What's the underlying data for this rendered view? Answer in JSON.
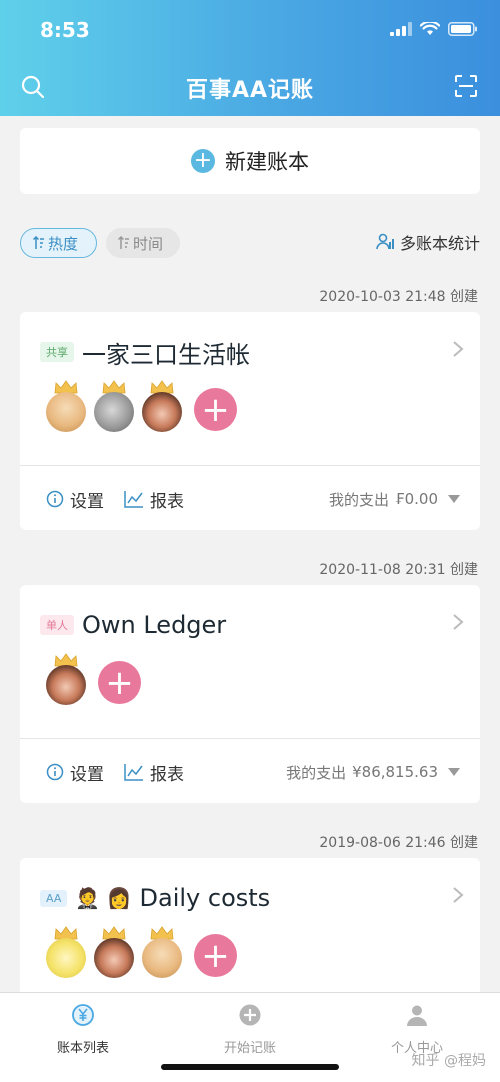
{
  "status_bar": {
    "time": "8:53"
  },
  "nav": {
    "title": "百事AA记账"
  },
  "new_book": {
    "label": "新建账本"
  },
  "sort": {
    "hot_label": "热度",
    "time_label": "时间",
    "multi_stats_label": "多账本统计"
  },
  "ledgers": [
    {
      "created": "2020-10-03 21:48 创建",
      "tag": "共享",
      "title": "一家三口生活帐",
      "settings_label": "设置",
      "report_label": "报表",
      "expense_label": "我的支出",
      "expense_value": "₣0.00"
    },
    {
      "created": "2020-11-08 20:31 创建",
      "tag": "单人",
      "title": "Own Ledger",
      "settings_label": "设置",
      "report_label": "报表",
      "expense_label": "我的支出",
      "expense_value": "¥86,815.63"
    },
    {
      "created": "2019-08-06 21:46 创建",
      "tag": "AA",
      "title": "Daily costs",
      "title_emojis": "🤵 👩"
    }
  ],
  "tabbar": {
    "tab1": "账本列表",
    "tab2": "开始记账",
    "tab3": "个人中心"
  },
  "watermark": "知乎 @程妈",
  "colors": {
    "header_start": "#5fd0ea",
    "header_end": "#3b8fdd",
    "add_member": "#e8789c",
    "accent": "#5bb8e0"
  }
}
